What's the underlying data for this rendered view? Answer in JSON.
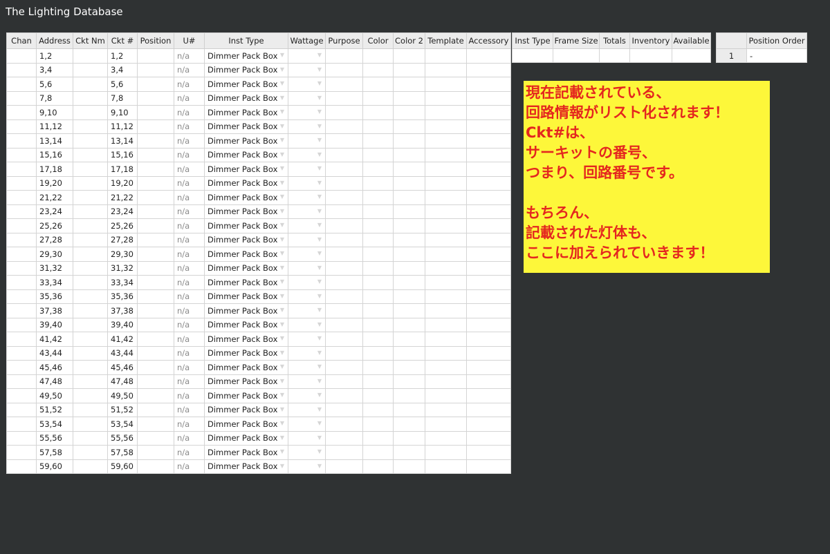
{
  "app": {
    "title": "The Lighting Database"
  },
  "main_table": {
    "columns": [
      "Chan",
      "Address",
      "Ckt Nm",
      "Ckt #",
      "Position",
      "U#",
      "Inst Type",
      "Wattage",
      "Purpose",
      "Color",
      "Color 2",
      "Template",
      "Accessory"
    ],
    "rows": [
      {
        "chan": "",
        "address": "1,2",
        "ckt_nm": "",
        "ckt_num": "1,2",
        "position": "",
        "unum": "n/a",
        "inst_type": "Dimmer Pack Box",
        "wattage": "",
        "purpose": "",
        "color": "",
        "color2": "",
        "template": "",
        "accessory": ""
      },
      {
        "chan": "",
        "address": "3,4",
        "ckt_nm": "",
        "ckt_num": "3,4",
        "position": "",
        "unum": "n/a",
        "inst_type": "Dimmer Pack Box",
        "wattage": "",
        "purpose": "",
        "color": "",
        "color2": "",
        "template": "",
        "accessory": ""
      },
      {
        "chan": "",
        "address": "5,6",
        "ckt_nm": "",
        "ckt_num": "5,6",
        "position": "",
        "unum": "n/a",
        "inst_type": "Dimmer Pack Box",
        "wattage": "",
        "purpose": "",
        "color": "",
        "color2": "",
        "template": "",
        "accessory": ""
      },
      {
        "chan": "",
        "address": "7,8",
        "ckt_nm": "",
        "ckt_num": "7,8",
        "position": "",
        "unum": "n/a",
        "inst_type": "Dimmer Pack Box",
        "wattage": "",
        "purpose": "",
        "color": "",
        "color2": "",
        "template": "",
        "accessory": ""
      },
      {
        "chan": "",
        "address": "9,10",
        "ckt_nm": "",
        "ckt_num": "9,10",
        "position": "",
        "unum": "n/a",
        "inst_type": "Dimmer Pack Box",
        "wattage": "",
        "purpose": "",
        "color": "",
        "color2": "",
        "template": "",
        "accessory": ""
      },
      {
        "chan": "",
        "address": "11,12",
        "ckt_nm": "",
        "ckt_num": "11,12",
        "position": "",
        "unum": "n/a",
        "inst_type": "Dimmer Pack Box",
        "wattage": "",
        "purpose": "",
        "color": "",
        "color2": "",
        "template": "",
        "accessory": ""
      },
      {
        "chan": "",
        "address": "13,14",
        "ckt_nm": "",
        "ckt_num": "13,14",
        "position": "",
        "unum": "n/a",
        "inst_type": "Dimmer Pack Box",
        "wattage": "",
        "purpose": "",
        "color": "",
        "color2": "",
        "template": "",
        "accessory": ""
      },
      {
        "chan": "",
        "address": "15,16",
        "ckt_nm": "",
        "ckt_num": "15,16",
        "position": "",
        "unum": "n/a",
        "inst_type": "Dimmer Pack Box",
        "wattage": "",
        "purpose": "",
        "color": "",
        "color2": "",
        "template": "",
        "accessory": ""
      },
      {
        "chan": "",
        "address": "17,18",
        "ckt_nm": "",
        "ckt_num": "17,18",
        "position": "",
        "unum": "n/a",
        "inst_type": "Dimmer Pack Box",
        "wattage": "",
        "purpose": "",
        "color": "",
        "color2": "",
        "template": "",
        "accessory": ""
      },
      {
        "chan": "",
        "address": "19,20",
        "ckt_nm": "",
        "ckt_num": "19,20",
        "position": "",
        "unum": "n/a",
        "inst_type": "Dimmer Pack Box",
        "wattage": "",
        "purpose": "",
        "color": "",
        "color2": "",
        "template": "",
        "accessory": ""
      },
      {
        "chan": "",
        "address": "21,22",
        "ckt_nm": "",
        "ckt_num": "21,22",
        "position": "",
        "unum": "n/a",
        "inst_type": "Dimmer Pack Box",
        "wattage": "",
        "purpose": "",
        "color": "",
        "color2": "",
        "template": "",
        "accessory": ""
      },
      {
        "chan": "",
        "address": "23,24",
        "ckt_nm": "",
        "ckt_num": "23,24",
        "position": "",
        "unum": "n/a",
        "inst_type": "Dimmer Pack Box",
        "wattage": "",
        "purpose": "",
        "color": "",
        "color2": "",
        "template": "",
        "accessory": ""
      },
      {
        "chan": "",
        "address": "25,26",
        "ckt_nm": "",
        "ckt_num": "25,26",
        "position": "",
        "unum": "n/a",
        "inst_type": "Dimmer Pack Box",
        "wattage": "",
        "purpose": "",
        "color": "",
        "color2": "",
        "template": "",
        "accessory": ""
      },
      {
        "chan": "",
        "address": "27,28",
        "ckt_nm": "",
        "ckt_num": "27,28",
        "position": "",
        "unum": "n/a",
        "inst_type": "Dimmer Pack Box",
        "wattage": "",
        "purpose": "",
        "color": "",
        "color2": "",
        "template": "",
        "accessory": ""
      },
      {
        "chan": "",
        "address": "29,30",
        "ckt_nm": "",
        "ckt_num": "29,30",
        "position": "",
        "unum": "n/a",
        "inst_type": "Dimmer Pack Box",
        "wattage": "",
        "purpose": "",
        "color": "",
        "color2": "",
        "template": "",
        "accessory": ""
      },
      {
        "chan": "",
        "address": "31,32",
        "ckt_nm": "",
        "ckt_num": "31,32",
        "position": "",
        "unum": "n/a",
        "inst_type": "Dimmer Pack Box",
        "wattage": "",
        "purpose": "",
        "color": "",
        "color2": "",
        "template": "",
        "accessory": ""
      },
      {
        "chan": "",
        "address": "33,34",
        "ckt_nm": "",
        "ckt_num": "33,34",
        "position": "",
        "unum": "n/a",
        "inst_type": "Dimmer Pack Box",
        "wattage": "",
        "purpose": "",
        "color": "",
        "color2": "",
        "template": "",
        "accessory": ""
      },
      {
        "chan": "",
        "address": "35,36",
        "ckt_nm": "",
        "ckt_num": "35,36",
        "position": "",
        "unum": "n/a",
        "inst_type": "Dimmer Pack Box",
        "wattage": "",
        "purpose": "",
        "color": "",
        "color2": "",
        "template": "",
        "accessory": ""
      },
      {
        "chan": "",
        "address": "37,38",
        "ckt_nm": "",
        "ckt_num": "37,38",
        "position": "",
        "unum": "n/a",
        "inst_type": "Dimmer Pack Box",
        "wattage": "",
        "purpose": "",
        "color": "",
        "color2": "",
        "template": "",
        "accessory": ""
      },
      {
        "chan": "",
        "address": "39,40",
        "ckt_nm": "",
        "ckt_num": "39,40",
        "position": "",
        "unum": "n/a",
        "inst_type": "Dimmer Pack Box",
        "wattage": "",
        "purpose": "",
        "color": "",
        "color2": "",
        "template": "",
        "accessory": ""
      },
      {
        "chan": "",
        "address": "41,42",
        "ckt_nm": "",
        "ckt_num": "41,42",
        "position": "",
        "unum": "n/a",
        "inst_type": "Dimmer Pack Box",
        "wattage": "",
        "purpose": "",
        "color": "",
        "color2": "",
        "template": "",
        "accessory": ""
      },
      {
        "chan": "",
        "address": "43,44",
        "ckt_nm": "",
        "ckt_num": "43,44",
        "position": "",
        "unum": "n/a",
        "inst_type": "Dimmer Pack Box",
        "wattage": "",
        "purpose": "",
        "color": "",
        "color2": "",
        "template": "",
        "accessory": ""
      },
      {
        "chan": "",
        "address": "45,46",
        "ckt_nm": "",
        "ckt_num": "45,46",
        "position": "",
        "unum": "n/a",
        "inst_type": "Dimmer Pack Box",
        "wattage": "",
        "purpose": "",
        "color": "",
        "color2": "",
        "template": "",
        "accessory": ""
      },
      {
        "chan": "",
        "address": "47,48",
        "ckt_nm": "",
        "ckt_num": "47,48",
        "position": "",
        "unum": "n/a",
        "inst_type": "Dimmer Pack Box",
        "wattage": "",
        "purpose": "",
        "color": "",
        "color2": "",
        "template": "",
        "accessory": ""
      },
      {
        "chan": "",
        "address": "49,50",
        "ckt_nm": "",
        "ckt_num": "49,50",
        "position": "",
        "unum": "n/a",
        "inst_type": "Dimmer Pack Box",
        "wattage": "",
        "purpose": "",
        "color": "",
        "color2": "",
        "template": "",
        "accessory": ""
      },
      {
        "chan": "",
        "address": "51,52",
        "ckt_nm": "",
        "ckt_num": "51,52",
        "position": "",
        "unum": "n/a",
        "inst_type": "Dimmer Pack Box",
        "wattage": "",
        "purpose": "",
        "color": "",
        "color2": "",
        "template": "",
        "accessory": ""
      },
      {
        "chan": "",
        "address": "53,54",
        "ckt_nm": "",
        "ckt_num": "53,54",
        "position": "",
        "unum": "n/a",
        "inst_type": "Dimmer Pack Box",
        "wattage": "",
        "purpose": "",
        "color": "",
        "color2": "",
        "template": "",
        "accessory": ""
      },
      {
        "chan": "",
        "address": "55,56",
        "ckt_nm": "",
        "ckt_num": "55,56",
        "position": "",
        "unum": "n/a",
        "inst_type": "Dimmer Pack Box",
        "wattage": "",
        "purpose": "",
        "color": "",
        "color2": "",
        "template": "",
        "accessory": ""
      },
      {
        "chan": "",
        "address": "57,58",
        "ckt_nm": "",
        "ckt_num": "57,58",
        "position": "",
        "unum": "n/a",
        "inst_type": "Dimmer Pack Box",
        "wattage": "",
        "purpose": "",
        "color": "",
        "color2": "",
        "template": "",
        "accessory": ""
      },
      {
        "chan": "",
        "address": "59,60",
        "ckt_nm": "",
        "ckt_num": "59,60",
        "position": "",
        "unum": "n/a",
        "inst_type": "Dimmer Pack Box",
        "wattage": "",
        "purpose": "",
        "color": "",
        "color2": "",
        "template": "",
        "accessory": ""
      }
    ]
  },
  "inventory_table": {
    "columns": [
      "Inst Type",
      "Frame Size",
      "Totals",
      "Inventory",
      "Available"
    ],
    "rows": [
      {
        "inst_type": "",
        "frame_size": "",
        "totals": "",
        "inventory": "",
        "available": ""
      }
    ]
  },
  "position_table": {
    "columns": [
      "",
      "Position Order"
    ],
    "rows": [
      {
        "index": "1",
        "position_order": "-"
      }
    ]
  },
  "annotation": {
    "lines": [
      "現在記載されている、",
      "回路情報がリスト化されます！",
      "Ckt#は、",
      "サーキットの番号、",
      "つまり、回路番号です。",
      "",
      "もちろん、",
      "記載された灯体も、",
      "ここに加えられていきます！"
    ],
    "background_color": "#fdf73a",
    "text_color": "#e4261f"
  },
  "icons": {
    "dropdown_arrow": "▼"
  }
}
